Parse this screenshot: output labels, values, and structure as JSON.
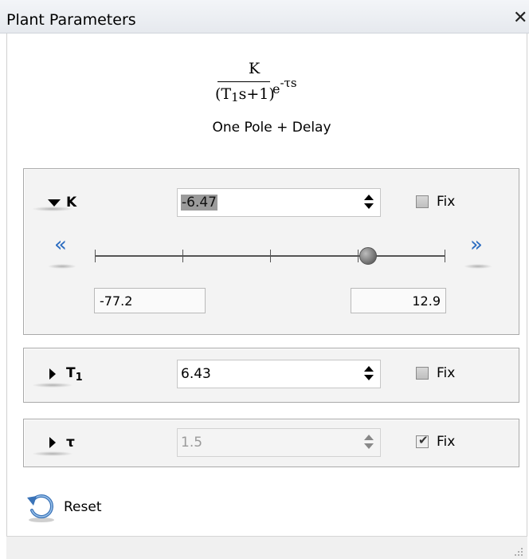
{
  "window": {
    "title": "Plant Parameters",
    "close_glyph": "✕"
  },
  "formula": {
    "numerator": "K",
    "denominator_open": "(T",
    "denominator_sub": "1",
    "denominator_rest": "s+1)",
    "exp_base": "e",
    "exp_power": "-τs",
    "model_name": "One Pole + Delay"
  },
  "params": {
    "k": {
      "label": "K",
      "value": "-6.47",
      "fix_label": "Fix",
      "fixed": false,
      "expanded": true,
      "slider": {
        "min": "-77.2",
        "max": "12.9",
        "fraction": 0.78,
        "left_chevron": "«",
        "right_chevron": "»"
      }
    },
    "t1": {
      "label": "T",
      "label_sub": "1",
      "value": "6.43",
      "fix_label": "Fix",
      "fixed": false,
      "expanded": false
    },
    "tau": {
      "label": "τ",
      "value": "1.5",
      "fix_label": "Fix",
      "fixed": true,
      "expanded": false
    }
  },
  "footer": {
    "reset_label": "Reset"
  },
  "icons": {
    "close": "close-icon",
    "reset": "reset-icon",
    "collapse": "triangle-down-icon",
    "expand": "triangle-right-icon",
    "spinner": "spinner-arrows-icon",
    "slider_left": "double-chevron-left-icon",
    "slider_right": "double-chevron-right-icon"
  },
  "colors": {
    "accent": "#2a6bc0",
    "group_background": "#f3f3f3",
    "selection": "#9b9b9b"
  }
}
